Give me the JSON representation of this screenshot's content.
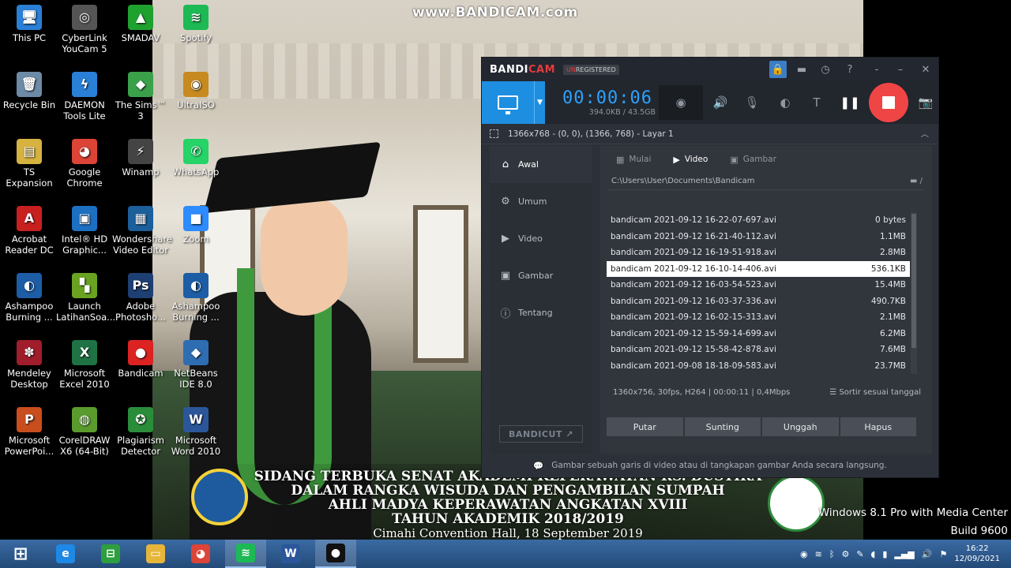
{
  "watermark": "www.BANDICAM.com",
  "desktop_icons": [
    {
      "label": "This PC",
      "color": "#2a7fd6",
      "glyph": "🖥"
    },
    {
      "label": "CyberLink YouCam 5",
      "color": "#555",
      "glyph": "◎"
    },
    {
      "label": "SMADAV",
      "color": "#1fa12f",
      "glyph": "▲"
    },
    {
      "label": "Spotify",
      "color": "#1db954",
      "glyph": "≋"
    },
    {
      "label": "Recycle Bin",
      "color": "#6d8aa6",
      "glyph": "🗑"
    },
    {
      "label": "DAEMON Tools Lite",
      "color": "#2a7fd6",
      "glyph": "ϟ"
    },
    {
      "label": "The Sims™ 3",
      "color": "#3aa14a",
      "glyph": "◆"
    },
    {
      "label": "UltraISO",
      "color": "#c78a1e",
      "glyph": "◉"
    },
    {
      "label": "TS Expansion",
      "color": "#d6b241",
      "glyph": "▤"
    },
    {
      "label": "Google Chrome",
      "color": "#db4437",
      "glyph": "◕"
    },
    {
      "label": "Winamp",
      "color": "#444",
      "glyph": "⚡"
    },
    {
      "label": "WhatsApp",
      "color": "#25d366",
      "glyph": "✆"
    },
    {
      "label": "Acrobat Reader DC",
      "color": "#c8201f",
      "glyph": "A"
    },
    {
      "label": "Intel® HD Graphic...",
      "color": "#1d6fc2",
      "glyph": "▣"
    },
    {
      "label": "Wondershare Video Editor",
      "color": "#1b5f9b",
      "glyph": "▦"
    },
    {
      "label": "Zoom",
      "color": "#2d8cff",
      "glyph": "■"
    },
    {
      "label": "Ashampoo Burning ...",
      "color": "#1d5da6",
      "glyph": "◐"
    },
    {
      "label": "Launch LatihanSoa...",
      "color": "#6aa321",
      "glyph": "▚"
    },
    {
      "label": "Adobe Photosho...",
      "color": "#1e3f73",
      "glyph": "Ps"
    },
    {
      "label": "Ashampoo Burning ...",
      "color": "#1d5da6",
      "glyph": "◐"
    },
    {
      "label": "Mendeley Desktop",
      "color": "#a01d2b",
      "glyph": "✽"
    },
    {
      "label": "Microsoft Excel 2010",
      "color": "#1f7244",
      "glyph": "X"
    },
    {
      "label": "Bandicam",
      "color": "#d22",
      "glyph": "●"
    },
    {
      "label": "NetBeans IDE 8.0",
      "color": "#2f6db3",
      "glyph": "◆"
    },
    {
      "label": "Microsoft PowerPoi...",
      "color": "#c94e1e",
      "glyph": "P"
    },
    {
      "label": "CorelDRAW X6 (64-Bit)",
      "color": "#5a9b2e",
      "glyph": "◍"
    },
    {
      "label": "Plagiarism Detector",
      "color": "#2a8d3a",
      "glyph": "✪"
    },
    {
      "label": "Microsoft Word 2010",
      "color": "#2b579a",
      "glyph": "W"
    }
  ],
  "banner": {
    "l1": "SIDANG TERBUKA SENAT AKADEMI KEPERAWATAN RS. DUSTIRA",
    "l2": "DALAM RANGKA WISUDA DAN PENGAMBILAN SUMPAH",
    "l3": "AHLI MADYA KEPERAWATAN ANGKATAN XVIII",
    "l4": "TAHUN AKADEMIK 2018/2019",
    "l5": "Cimahi Convention Hall, 18 September 2019"
  },
  "os_watermark": {
    "edition": "Windows 8.1 Pro with Media Center",
    "build": "Build 9600"
  },
  "bandicam": {
    "logo_a": "BANDI",
    "logo_b": "CAM",
    "unreg_a": "UN",
    "unreg_b": "REGISTERED",
    "title_icons": [
      "lock-icon",
      "folder-icon",
      "clock-icon",
      "help-icon",
      "minimize-icon",
      "restore-icon",
      "close-icon"
    ],
    "timer": "00:00:06",
    "size": "394.0KB / 43.5GB",
    "region": "1366x768 - (0, 0), (1366, 768) - Layar 1",
    "sidebar": [
      {
        "label": "Awal",
        "icon": "⌂"
      },
      {
        "label": "Umum",
        "icon": "⚙"
      },
      {
        "label": "Video",
        "icon": "▶"
      },
      {
        "label": "Gambar",
        "icon": "▣"
      },
      {
        "label": "Tentang",
        "icon": "ⓘ"
      }
    ],
    "bandicut": "BANDICUT ↗",
    "tabs": [
      {
        "label": "Mulai",
        "icon": "▦"
      },
      {
        "label": "Video",
        "icon": "▶"
      },
      {
        "label": "Gambar",
        "icon": "▣"
      }
    ],
    "path": "C:\\Users\\User\\Documents\\Bandicam",
    "files": [
      {
        "name": "bandicam 2021-09-12 16-22-07-697.avi",
        "size": "0 bytes"
      },
      {
        "name": "bandicam 2021-09-12 16-21-40-112.avi",
        "size": "1.1MB"
      },
      {
        "name": "bandicam 2021-09-12 16-19-51-918.avi",
        "size": "2.8MB"
      },
      {
        "name": "bandicam 2021-09-12 16-10-14-406.avi",
        "size": "536.1KB"
      },
      {
        "name": "bandicam 2021-09-12 16-03-54-523.avi",
        "size": "15.4MB"
      },
      {
        "name": "bandicam 2021-09-12 16-03-37-336.avi",
        "size": "490.7KB"
      },
      {
        "name": "bandicam 2021-09-12 16-02-15-313.avi",
        "size": "2.1MB"
      },
      {
        "name": "bandicam 2021-09-12 15-59-14-699.avi",
        "size": "6.2MB"
      },
      {
        "name": "bandicam 2021-09-12 15-58-42-878.avi",
        "size": "7.6MB"
      },
      {
        "name": "bandicam 2021-09-08 18-18-09-583.avi",
        "size": "23.7MB"
      }
    ],
    "selected_index": 3,
    "file_info": "1360x756, 30fps, H264 | 00:00:11 | 0,4Mbps",
    "sort": "Sortir sesuai tanggal",
    "actions": [
      "Putar",
      "Sunting",
      "Unggah",
      "Hapus"
    ],
    "hint": "Gambar sebuah garis di video atau di tangkapan gambar Anda secara langsung."
  },
  "taskbar": {
    "apps": [
      {
        "name": "start",
        "color": "transparent",
        "glyph": "⊞"
      },
      {
        "name": "internet-explorer",
        "color": "#1e88e5",
        "glyph": "e"
      },
      {
        "name": "store",
        "color": "#2e9e3e",
        "glyph": "⊟"
      },
      {
        "name": "file-explorer",
        "color": "#e6b53a",
        "glyph": "▭"
      },
      {
        "name": "chrome",
        "color": "#db4437",
        "glyph": "◕"
      },
      {
        "name": "spotify",
        "color": "#1db954",
        "glyph": "≋"
      },
      {
        "name": "word",
        "color": "#2b579a",
        "glyph": "W"
      },
      {
        "name": "bandicam",
        "color": "#111",
        "glyph": "●"
      }
    ],
    "time": "16:22",
    "date": "12/09/2021"
  }
}
